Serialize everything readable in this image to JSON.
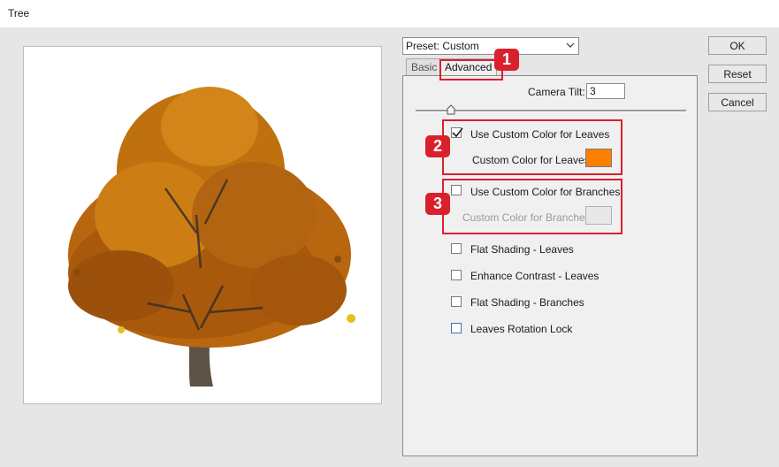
{
  "window": {
    "title": "Tree"
  },
  "preset": {
    "value": "Preset: Custom"
  },
  "buttons": {
    "ok": "OK",
    "reset": "Reset",
    "cancel": "Cancel"
  },
  "tabs": [
    {
      "label": "Basic"
    },
    {
      "label": "Advanced"
    }
  ],
  "advanced": {
    "camera_tilt_label": "Camera Tilt:",
    "camera_tilt_value": "3",
    "use_custom_leaves": {
      "label": "Use Custom Color for Leaves",
      "checked": true
    },
    "custom_leaves_color_label": "Custom Color for Leaves:",
    "custom_leaves_color": "#ff8000",
    "use_custom_branches": {
      "label": "Use Custom Color for Branches",
      "checked": false
    },
    "custom_branches_color_label": "Custom Color for Branches:",
    "custom_branches_color": "#e8e8e8",
    "options": [
      {
        "label": "Flat Shading - Leaves",
        "checked": false
      },
      {
        "label": "Enhance Contrast - Leaves",
        "checked": false
      },
      {
        "label": "Flat Shading - Branches",
        "checked": false
      },
      {
        "label": "Leaves Rotation Lock",
        "checked": false
      }
    ]
  },
  "callouts": [
    "1",
    "2",
    "3"
  ],
  "colors": {
    "callout": "#d9202d",
    "leaves_foliage": "#b8660f"
  }
}
